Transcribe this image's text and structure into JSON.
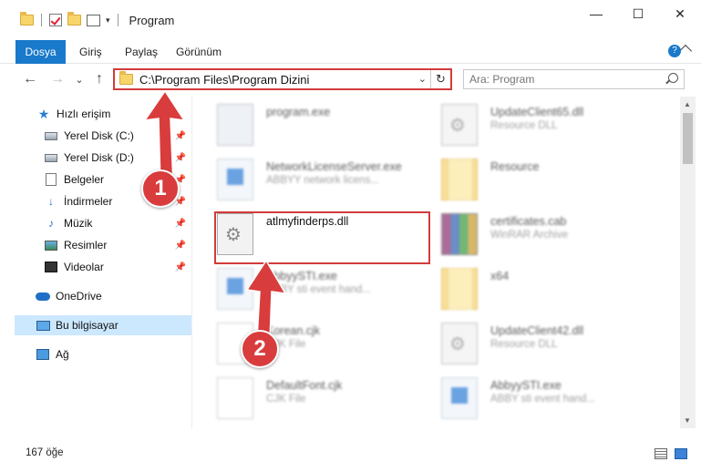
{
  "window": {
    "title": "Program",
    "buttons": {
      "minimize": "—",
      "maximize": "☐",
      "close": "✕"
    }
  },
  "ribbon": {
    "tabs": [
      "Dosya",
      "Giriş",
      "Paylaş",
      "Görünüm"
    ],
    "help": "?"
  },
  "nav": {
    "back": "←",
    "forward": "→",
    "recent": "⌄",
    "up": "↑",
    "address": "C:\\Program Files\\Program Dizini",
    "dropdown": "⌄",
    "refresh": "↻",
    "search_placeholder": "Ara: Program"
  },
  "sidebar": {
    "items": [
      {
        "label": "Hızlı erişim",
        "icon": "star-icon"
      },
      {
        "label": "Yerel Disk (C:)",
        "icon": "drive-icon",
        "pinned": true
      },
      {
        "label": "Yerel Disk (D:)",
        "icon": "drive-icon",
        "pinned": true
      },
      {
        "label": "Belgeler",
        "icon": "document-icon",
        "pinned": true
      },
      {
        "label": "İndirmeler",
        "icon": "download-icon",
        "pinned": true
      },
      {
        "label": "Müzik",
        "icon": "music-icon",
        "pinned": true
      },
      {
        "label": "Resimler",
        "icon": "pictures-icon",
        "pinned": true
      },
      {
        "label": "Videolar",
        "icon": "video-icon",
        "pinned": true
      },
      {
        "label": "OneDrive",
        "icon": "onedrive-icon"
      },
      {
        "label": "Bu bilgisayar",
        "icon": "computer-icon",
        "selected": true
      },
      {
        "label": "Ağ",
        "icon": "network-icon"
      }
    ],
    "pin_glyph": "📌"
  },
  "files": [
    {
      "name": "program.exe",
      "desc": "",
      "type": "installer"
    },
    {
      "name": "UpdateClient65.dll",
      "desc": "Resource DLL",
      "type": "dll"
    },
    {
      "name": "NetworkLicenseServer.exe",
      "desc": "ABBYY network licens...",
      "type": "exe"
    },
    {
      "name": "Resource",
      "desc": "",
      "type": "folder"
    },
    {
      "name": "atlmyfinderps.dll",
      "desc": "",
      "type": "dll"
    },
    {
      "name": "certificates.cab",
      "desc": "WinRAR Archive",
      "type": "rar"
    },
    {
      "name": "AbbyySTI.exe",
      "desc": "ABBY sti event hand...",
      "type": "exe"
    },
    {
      "name": "x64",
      "desc": "",
      "type": "folder"
    },
    {
      "name": "Korean.cjk",
      "desc": "CJK File",
      "type": "file"
    },
    {
      "name": "UpdateClient42.dll",
      "desc": "Resource DLL",
      "type": "dll"
    },
    {
      "name": "DefaultFont.cjk",
      "desc": "CJK File",
      "type": "file"
    },
    {
      "name": "AbbyySTI.exe",
      "desc": "ABBY sti event hand...",
      "type": "exe"
    }
  ],
  "status": {
    "count": "167 öğe"
  },
  "annotations": {
    "step1": "1",
    "step2": "2",
    "accent": "#d93c3c"
  }
}
